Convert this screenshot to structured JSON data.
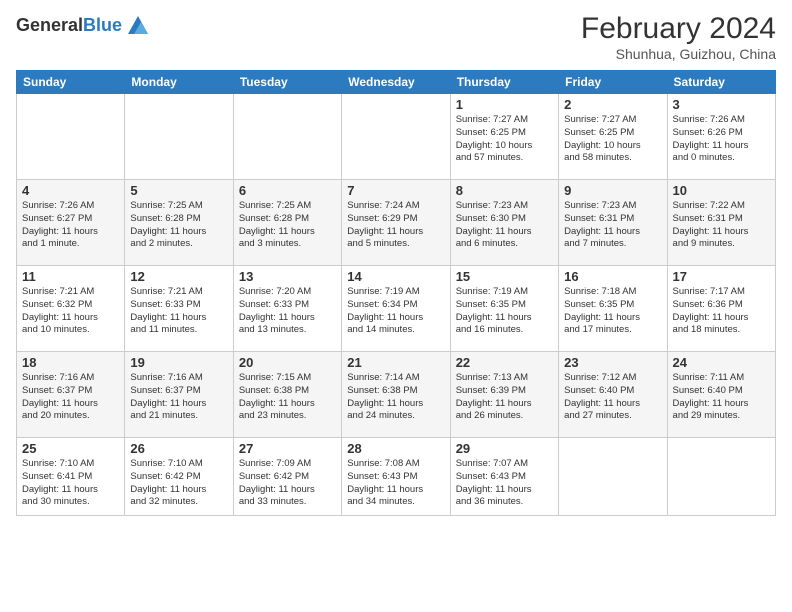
{
  "header": {
    "logo_general": "General",
    "logo_blue": "Blue",
    "month_year": "February 2024",
    "location": "Shunhua, Guizhou, China"
  },
  "weekdays": [
    "Sunday",
    "Monday",
    "Tuesday",
    "Wednesday",
    "Thursday",
    "Friday",
    "Saturday"
  ],
  "weeks": [
    [
      {
        "day": "",
        "info": ""
      },
      {
        "day": "",
        "info": ""
      },
      {
        "day": "",
        "info": ""
      },
      {
        "day": "",
        "info": ""
      },
      {
        "day": "1",
        "info": "Sunrise: 7:27 AM\nSunset: 6:25 PM\nDaylight: 10 hours\nand 57 minutes."
      },
      {
        "day": "2",
        "info": "Sunrise: 7:27 AM\nSunset: 6:25 PM\nDaylight: 10 hours\nand 58 minutes."
      },
      {
        "day": "3",
        "info": "Sunrise: 7:26 AM\nSunset: 6:26 PM\nDaylight: 11 hours\nand 0 minutes."
      }
    ],
    [
      {
        "day": "4",
        "info": "Sunrise: 7:26 AM\nSunset: 6:27 PM\nDaylight: 11 hours\nand 1 minute."
      },
      {
        "day": "5",
        "info": "Sunrise: 7:25 AM\nSunset: 6:28 PM\nDaylight: 11 hours\nand 2 minutes."
      },
      {
        "day": "6",
        "info": "Sunrise: 7:25 AM\nSunset: 6:28 PM\nDaylight: 11 hours\nand 3 minutes."
      },
      {
        "day": "7",
        "info": "Sunrise: 7:24 AM\nSunset: 6:29 PM\nDaylight: 11 hours\nand 5 minutes."
      },
      {
        "day": "8",
        "info": "Sunrise: 7:23 AM\nSunset: 6:30 PM\nDaylight: 11 hours\nand 6 minutes."
      },
      {
        "day": "9",
        "info": "Sunrise: 7:23 AM\nSunset: 6:31 PM\nDaylight: 11 hours\nand 7 minutes."
      },
      {
        "day": "10",
        "info": "Sunrise: 7:22 AM\nSunset: 6:31 PM\nDaylight: 11 hours\nand 9 minutes."
      }
    ],
    [
      {
        "day": "11",
        "info": "Sunrise: 7:21 AM\nSunset: 6:32 PM\nDaylight: 11 hours\nand 10 minutes."
      },
      {
        "day": "12",
        "info": "Sunrise: 7:21 AM\nSunset: 6:33 PM\nDaylight: 11 hours\nand 11 minutes."
      },
      {
        "day": "13",
        "info": "Sunrise: 7:20 AM\nSunset: 6:33 PM\nDaylight: 11 hours\nand 13 minutes."
      },
      {
        "day": "14",
        "info": "Sunrise: 7:19 AM\nSunset: 6:34 PM\nDaylight: 11 hours\nand 14 minutes."
      },
      {
        "day": "15",
        "info": "Sunrise: 7:19 AM\nSunset: 6:35 PM\nDaylight: 11 hours\nand 16 minutes."
      },
      {
        "day": "16",
        "info": "Sunrise: 7:18 AM\nSunset: 6:35 PM\nDaylight: 11 hours\nand 17 minutes."
      },
      {
        "day": "17",
        "info": "Sunrise: 7:17 AM\nSunset: 6:36 PM\nDaylight: 11 hours\nand 18 minutes."
      }
    ],
    [
      {
        "day": "18",
        "info": "Sunrise: 7:16 AM\nSunset: 6:37 PM\nDaylight: 11 hours\nand 20 minutes."
      },
      {
        "day": "19",
        "info": "Sunrise: 7:16 AM\nSunset: 6:37 PM\nDaylight: 11 hours\nand 21 minutes."
      },
      {
        "day": "20",
        "info": "Sunrise: 7:15 AM\nSunset: 6:38 PM\nDaylight: 11 hours\nand 23 minutes."
      },
      {
        "day": "21",
        "info": "Sunrise: 7:14 AM\nSunset: 6:38 PM\nDaylight: 11 hours\nand 24 minutes."
      },
      {
        "day": "22",
        "info": "Sunrise: 7:13 AM\nSunset: 6:39 PM\nDaylight: 11 hours\nand 26 minutes."
      },
      {
        "day": "23",
        "info": "Sunrise: 7:12 AM\nSunset: 6:40 PM\nDaylight: 11 hours\nand 27 minutes."
      },
      {
        "day": "24",
        "info": "Sunrise: 7:11 AM\nSunset: 6:40 PM\nDaylight: 11 hours\nand 29 minutes."
      }
    ],
    [
      {
        "day": "25",
        "info": "Sunrise: 7:10 AM\nSunset: 6:41 PM\nDaylight: 11 hours\nand 30 minutes."
      },
      {
        "day": "26",
        "info": "Sunrise: 7:10 AM\nSunset: 6:42 PM\nDaylight: 11 hours\nand 32 minutes."
      },
      {
        "day": "27",
        "info": "Sunrise: 7:09 AM\nSunset: 6:42 PM\nDaylight: 11 hours\nand 33 minutes."
      },
      {
        "day": "28",
        "info": "Sunrise: 7:08 AM\nSunset: 6:43 PM\nDaylight: 11 hours\nand 34 minutes."
      },
      {
        "day": "29",
        "info": "Sunrise: 7:07 AM\nSunset: 6:43 PM\nDaylight: 11 hours\nand 36 minutes."
      },
      {
        "day": "",
        "info": ""
      },
      {
        "day": "",
        "info": ""
      }
    ]
  ]
}
